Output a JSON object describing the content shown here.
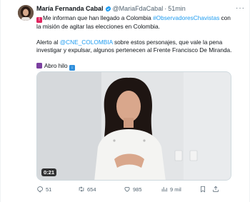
{
  "tweet": {
    "author_name": "María Fernanda Cabal",
    "handle": "@MariaFdaCabal",
    "dot": "·",
    "time": "51min",
    "more": "···",
    "line1_text": "Me informan que han llegado a Colombia ",
    "line1_hashtag": "#ObservadoresChavistas",
    "line1_rest": " con la misión de agitar las elecciones en Colombia.",
    "line2_start": "Alerto al ",
    "line2_mention": "@CNE_COLOMBIA",
    "line2_rest": " sobre estos personajes, que vale la pena investigar y expulsar, algunos pertenecen al Frente Francisco De Miranda.",
    "line3_text": "Abro hilo",
    "video_duration": "0:21"
  },
  "actions": {
    "replies": "51",
    "retweets": "654",
    "likes": "985",
    "views": "9 mil"
  },
  "icons": {
    "verified": "verified-badge-icon",
    "reply": "reply-icon",
    "retweet": "retweet-icon",
    "like": "heart-icon",
    "views": "views-chart-icon",
    "bookmark": "bookmark-icon",
    "share": "share-icon"
  },
  "colors": {
    "link": "#1d9bf0",
    "verified": "#1d9bf0",
    "muted": "#536471"
  }
}
